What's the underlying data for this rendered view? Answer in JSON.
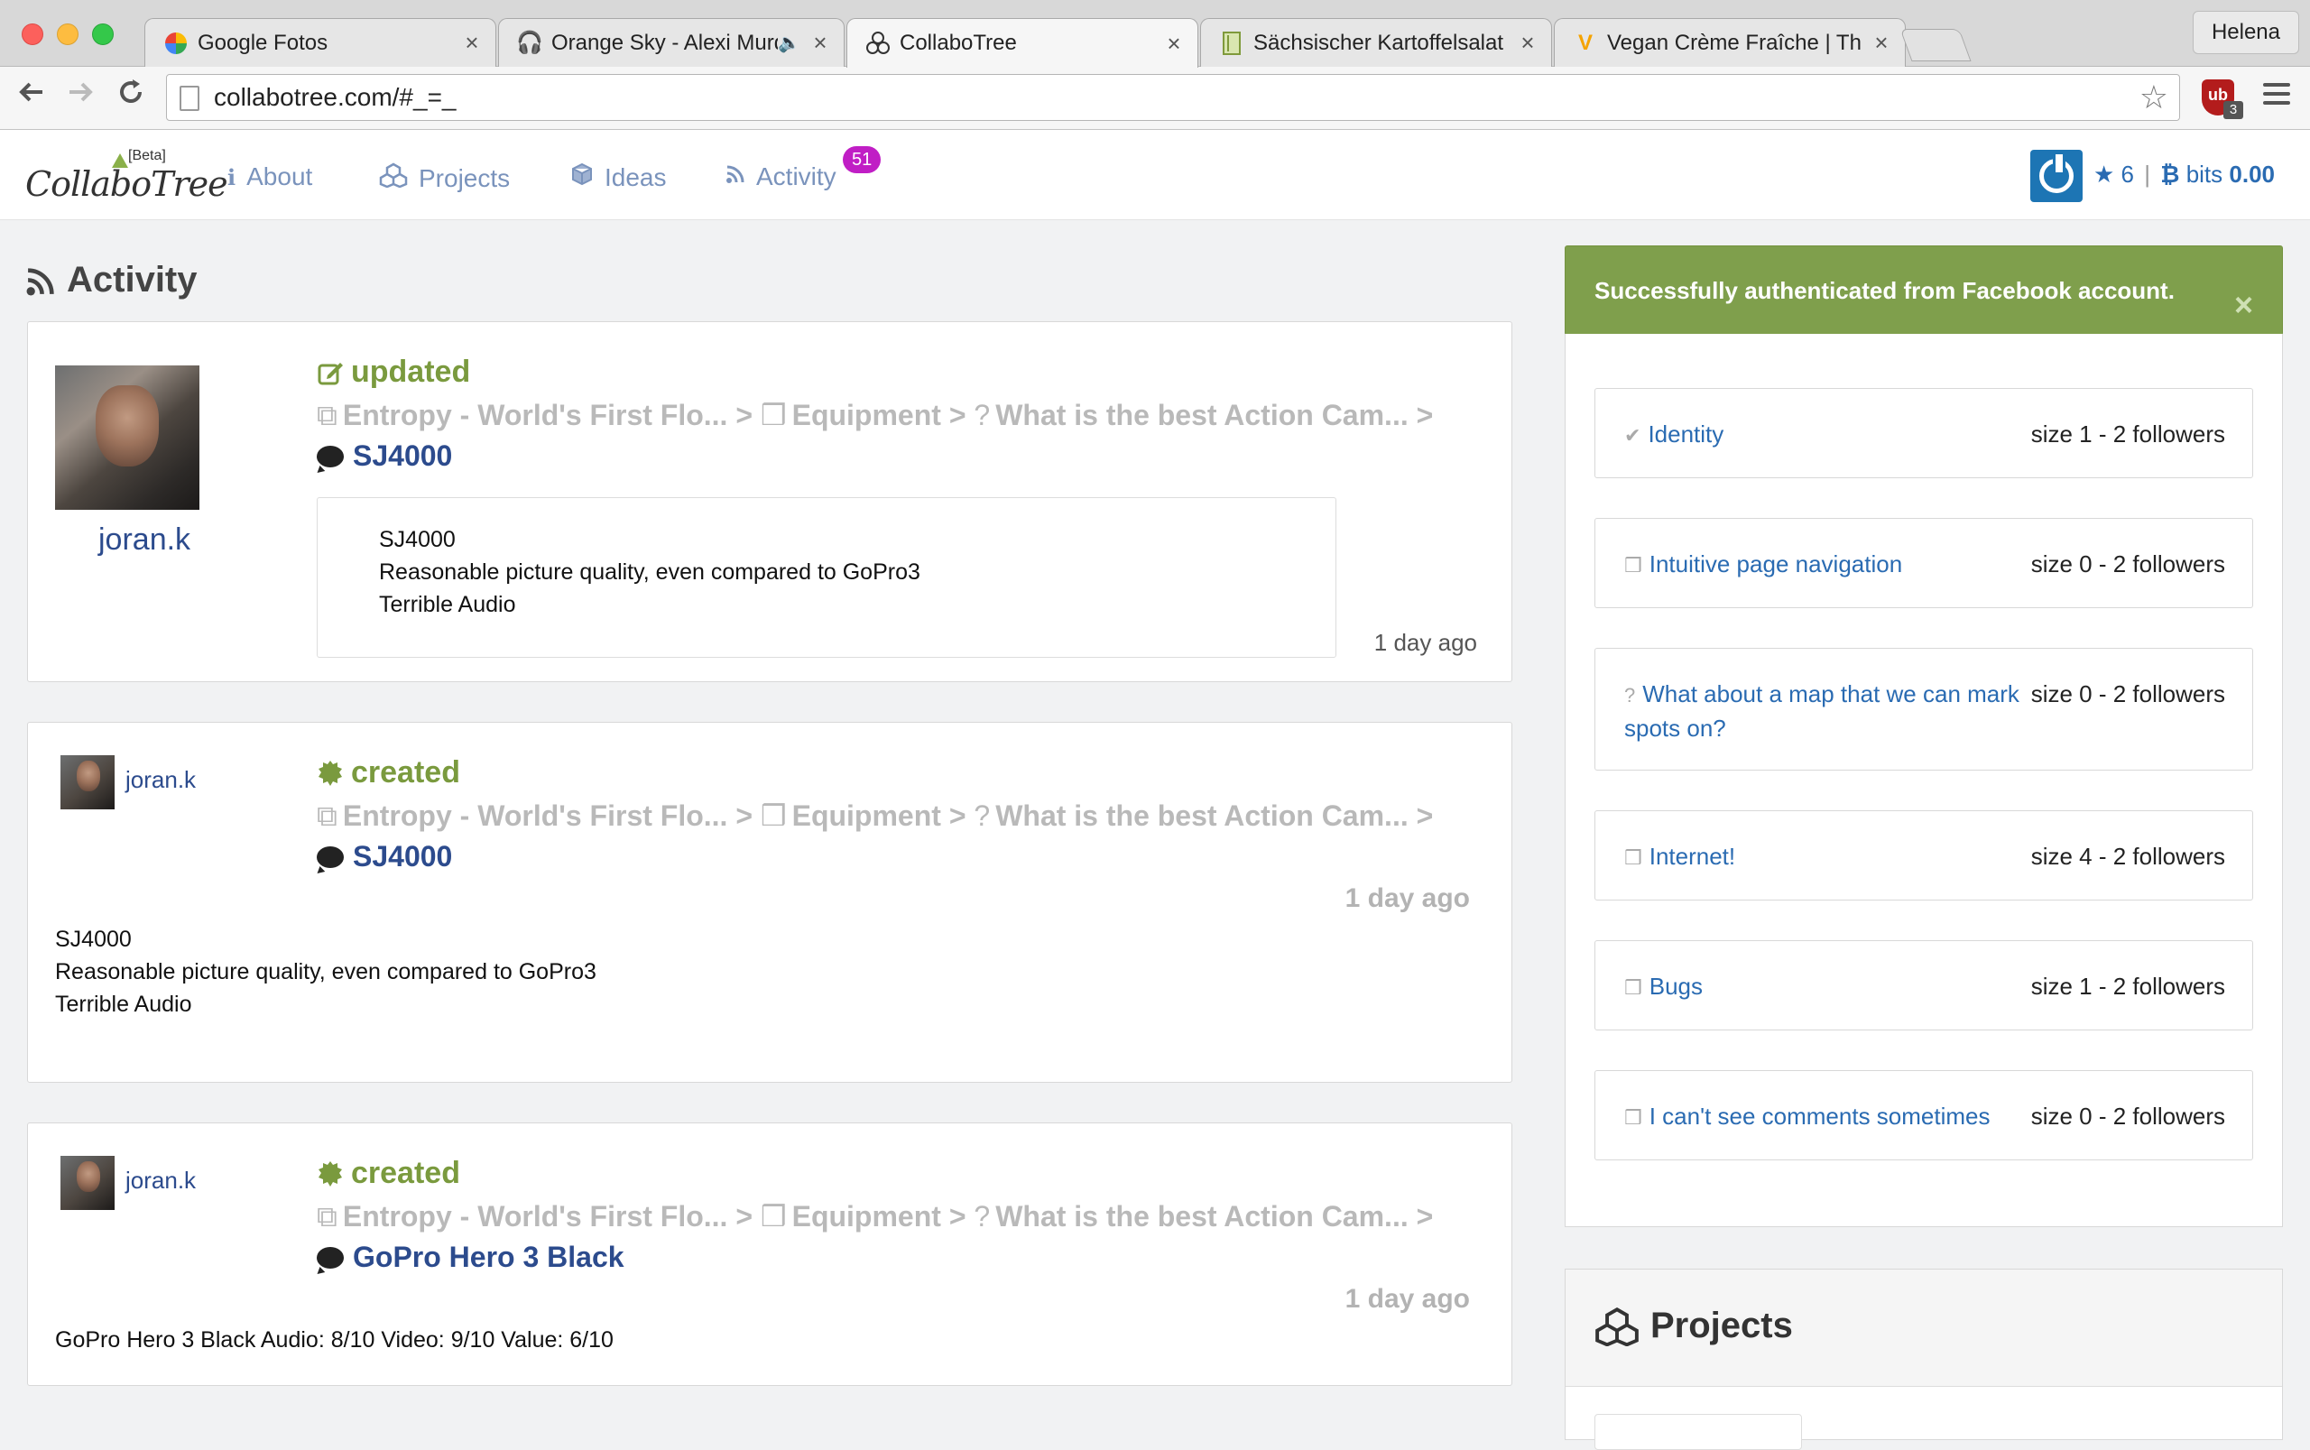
{
  "browser": {
    "tabs": [
      {
        "label": "Google Fotos",
        "icon": "google-photos-icon"
      },
      {
        "label": "Orange Sky - Alexi Murdoch",
        "icon": "headphones-icon"
      },
      {
        "label": "CollaboTree",
        "icon": "collabotree-icon"
      },
      {
        "label": "Sächsischer Kartoffelsalat",
        "icon": "bookmark-icon"
      },
      {
        "label": "Vegan Crème Fraîche | The",
        "icon": "vegan-icon"
      }
    ],
    "active_tab": 2,
    "profile": "Helena",
    "url": "collabotree.com/#_=_",
    "ext_badge": "3"
  },
  "site": {
    "logo_text": "CollaboTree",
    "logo_badge": "[Beta]",
    "nav": [
      {
        "label": "About",
        "icon": "info-icon"
      },
      {
        "label": "Projects",
        "icon": "cubes-icon"
      },
      {
        "label": "Ideas",
        "icon": "cube-icon"
      },
      {
        "label": "Activity",
        "icon": "rss-icon"
      }
    ],
    "activity_count": "51",
    "stars": "6",
    "bits_label": "bits",
    "bits_value": "0.00"
  },
  "page": {
    "title": "Activity"
  },
  "feed": [
    {
      "user": "joran.k",
      "action": "updated",
      "crumbs": [
        "Entropy - World's First Flo...",
        "Equipment",
        "What is the best Action Cam..."
      ],
      "target": "SJ4000",
      "content": [
        "SJ4000",
        "Reasonable picture quality, even compared to GoPro3",
        "Terrible Audio"
      ],
      "time": "1 day ago"
    },
    {
      "user": "joran.k",
      "action": "created",
      "crumbs": [
        "Entropy - World's First Flo...",
        "Equipment",
        "What is the best Action Cam..."
      ],
      "target": "SJ4000",
      "content": [
        "SJ4000",
        "Reasonable picture quality, even compared to GoPro3",
        "Terrible Audio"
      ],
      "time": "1 day ago"
    },
    {
      "user": "joran.k",
      "action": "created",
      "crumbs": [
        "Entropy - World's First Flo...",
        "Equipment",
        "What is the best Action Cam..."
      ],
      "target": "GoPro Hero 3 Black",
      "content": [
        "GoPro Hero 3 Black Audio: 8/10 Video: 9/10 Value: 6/10"
      ],
      "time": "1 day ago"
    }
  ],
  "alert": {
    "message": "Successfully authenticated from Facebook account.",
    "close": "×"
  },
  "topics": [
    {
      "icon": "✔",
      "name": "Identity",
      "meta": "size 1 - 2 followers"
    },
    {
      "icon": "❒",
      "name": "Intuitive page navigation",
      "meta": "size 0 - 2 followers"
    },
    {
      "icon": "?",
      "name": "What about a map that we can mark spots on?",
      "meta": "size 0 - 2 followers"
    },
    {
      "icon": "❒",
      "name": "Internet!",
      "meta": "size 4 - 2 followers"
    },
    {
      "icon": "❒",
      "name": "Bugs",
      "meta": "size 1 - 2 followers"
    },
    {
      "icon": "❒",
      "name": "I can't see comments sometimes",
      "meta": "size 0 - 2 followers"
    }
  ],
  "projects_panel": {
    "title": "Projects"
  }
}
